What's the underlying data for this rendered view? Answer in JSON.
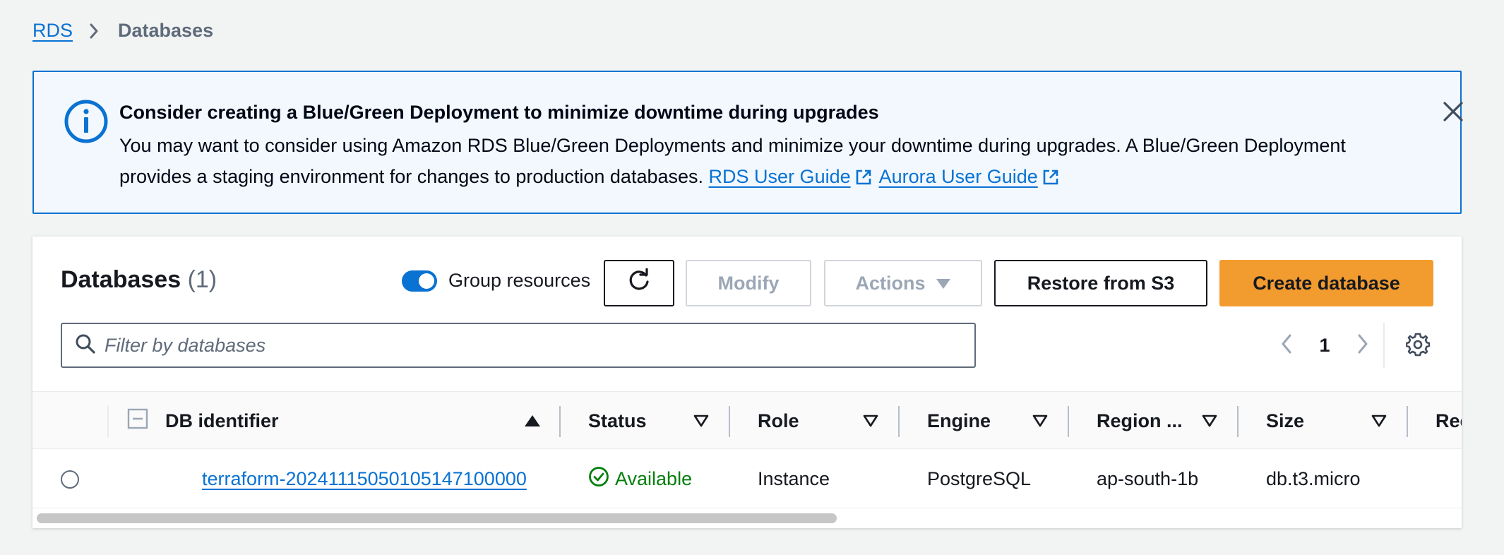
{
  "breadcrumb": {
    "root": "RDS",
    "current": "Databases"
  },
  "banner": {
    "title": "Consider creating a Blue/Green Deployment to minimize downtime during upgrades",
    "body": "You may want to consider using Amazon RDS Blue/Green Deployments and minimize your downtime during upgrades. A Blue/Green Deployment provides a staging environment for changes to production databases.",
    "link_rds": "RDS User Guide",
    "link_aurora": "Aurora User Guide"
  },
  "panel": {
    "title": "Databases",
    "count": "(1)",
    "group_toggle_label": "Group resources",
    "group_toggle_on": true,
    "modify_label": "Modify",
    "actions_label": "Actions",
    "restore_label": "Restore from S3",
    "create_label": "Create database",
    "filter_placeholder": "Filter by databases",
    "filter_value": "",
    "page_number": "1"
  },
  "table": {
    "columns": {
      "db_identifier": "DB identifier",
      "status": "Status",
      "role": "Role",
      "engine": "Engine",
      "region": "Region ...",
      "size": "Size",
      "recommendations": "Rec"
    },
    "rows": [
      {
        "db_identifier": "terraform-20241115050105147100000",
        "status": "Available",
        "role": "Instance",
        "engine": "PostgreSQL",
        "region": "ap-south-1b",
        "size": "db.t3.micro"
      }
    ]
  },
  "colors": {
    "link": "#0972d3",
    "primary_button": "#f29b2f",
    "success": "#037f0c",
    "banner_bg": "#f2f8fd"
  }
}
